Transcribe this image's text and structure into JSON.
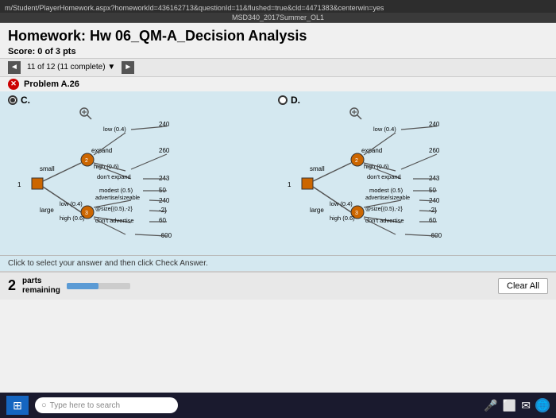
{
  "url": {
    "text": "m/Student/PlayerHomework.aspx?homeworkId=436162713&questionId=11&flushed=true&cld=4471383&centerwin=yes"
  },
  "course": {
    "label": "MSD340_2017Summer_OL1"
  },
  "homework": {
    "title": "Homework: Hw 06_QM-A_Decision Analysis",
    "score": "Score: 0 of 3 pts"
  },
  "navigation": {
    "prev_label": "◄",
    "next_label": "►",
    "progress": "11 of 12 (11 complete)",
    "dropdown_symbol": "▼"
  },
  "problem": {
    "label": "Problem A.26",
    "status_icon": "✕"
  },
  "answers": {
    "option_c": "C.",
    "option_d": "D."
  },
  "click_instruction": "Click to select your answer and then click Check Answer.",
  "footer": {
    "parts_number": "2",
    "parts_label": "parts\nremaining",
    "clear_all": "Clear All"
  },
  "taskbar": {
    "search_placeholder": "Type here to search",
    "windows_icon": "⊞"
  },
  "diagram": {
    "nodes": {
      "small_label": "small",
      "large_label": "large",
      "expand_label": "expand",
      "dont_expand_label": "don't expand",
      "advertise_label": "advertise",
      "dont_advertise_label": "don't advertise",
      "low_04_label": "low (0.4)",
      "high_06_label": "high (0.6)",
      "modest_05_label": "modest (0.5)",
      "low_04_2_label": "low (0.4)",
      "high_06_2_label": "high (0.6)",
      "val_240": "240",
      "val_260": "260",
      "val_243": "243",
      "val_50": "50",
      "val_240b": "240",
      "val_neg2": "-2}",
      "val_60": "60",
      "val_neg600": "-600",
      "size_note": "@size{(0.5),-2}"
    }
  }
}
